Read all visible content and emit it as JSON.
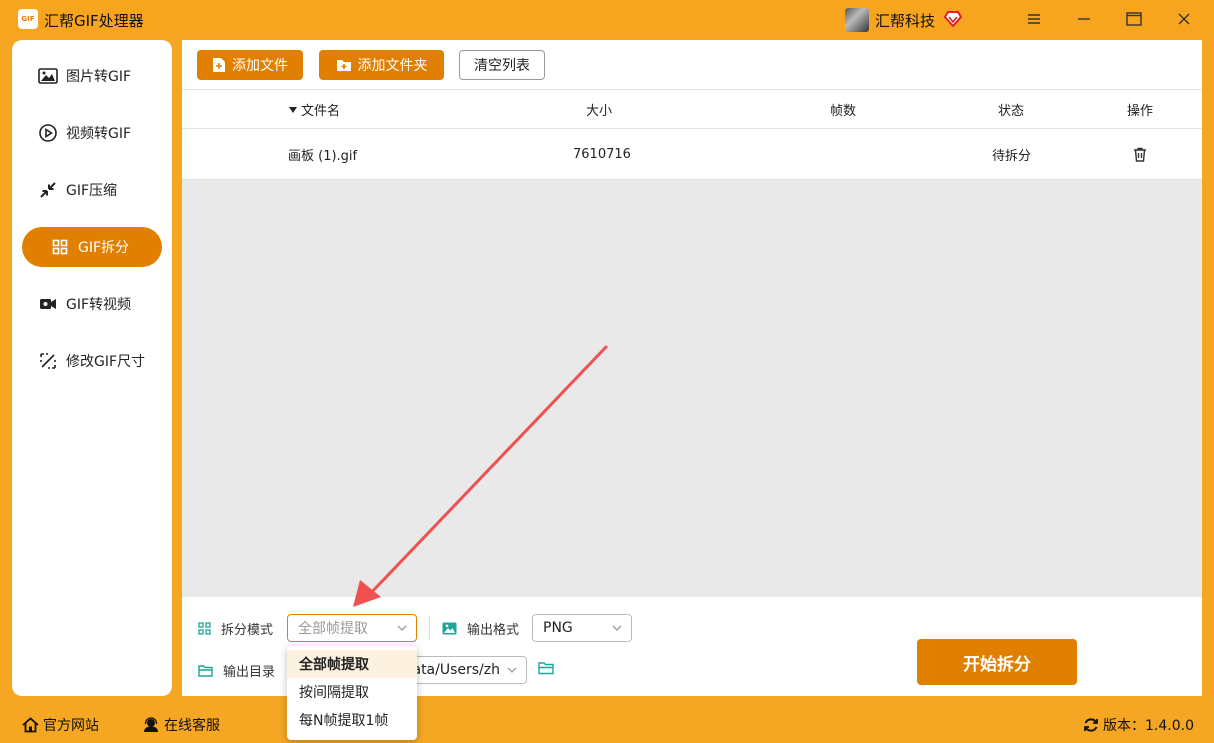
{
  "app": {
    "logo_text": "GIF",
    "title": "汇帮GIF处理器"
  },
  "user": {
    "name": "汇帮科技"
  },
  "sidebar": {
    "items": [
      {
        "label": "图片转GIF",
        "icon": "image-icon"
      },
      {
        "label": "视频转GIF",
        "icon": "play-icon"
      },
      {
        "label": "GIF压缩",
        "icon": "compress-icon"
      },
      {
        "label": "GIF拆分",
        "icon": "split-grid-icon",
        "active": true
      },
      {
        "label": "GIF转视频",
        "icon": "video-camera-icon"
      },
      {
        "label": "修改GIF尺寸",
        "icon": "resize-icon"
      }
    ]
  },
  "toolbar": {
    "add_file_label": "添加文件",
    "add_folder_label": "添加文件夹",
    "clear_list_label": "清空列表"
  },
  "table": {
    "columns": [
      "文件名",
      "大小",
      "帧数",
      "状态",
      "操作"
    ],
    "rows": [
      {
        "name": "画板 (1).gif",
        "size": "7610716",
        "frames": "",
        "status": "待拆分"
      }
    ]
  },
  "settings": {
    "split_mode_label": "拆分模式",
    "split_mode_value": "全部帧提取",
    "output_format_label": "输出格式",
    "output_format_value": "PNG",
    "output_dir_label": "输出目录",
    "output_dir_value": "ata/Users/zh",
    "start_label": "开始拆分"
  },
  "split_mode_options": [
    "全部帧提取",
    "按间隔提取",
    "每N帧提取1帧"
  ],
  "footer": {
    "website_label": "官方网站",
    "support_label": "在线客服",
    "version_label": "版本：1.4.0.0"
  },
  "colors": {
    "accent": "#e07f00",
    "titlebar": "#f7a51f",
    "annotation_arrow": "#f05050"
  }
}
